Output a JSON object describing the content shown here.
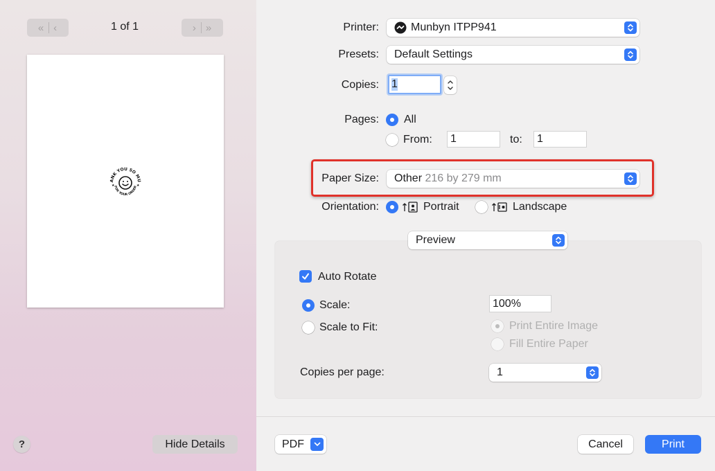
{
  "preview": {
    "page_count": "1 of 1",
    "stamp_text_top": "THANK YOU SO MUCH",
    "stamp_text_bottom": "FOR YOUR ORDER",
    "help_label": "?",
    "hide_details_label": "Hide Details"
  },
  "form": {
    "printer_label": "Printer:",
    "printer_value": "Munbyn ITPP941",
    "presets_label": "Presets:",
    "presets_value": "Default Settings",
    "copies_label": "Copies:",
    "copies_value": "1",
    "pages_label": "Pages:",
    "pages_all": "All",
    "pages_from_label": "From:",
    "pages_from_value": "1",
    "pages_to_label": "to:",
    "pages_to_value": "1",
    "paper_size_label": "Paper Size:",
    "paper_size_value": "Other",
    "paper_size_detail": "216 by 279 mm",
    "orientation_label": "Orientation:",
    "portrait_label": "Portrait",
    "landscape_label": "Landscape",
    "section_popup_value": "Preview"
  },
  "preview_options": {
    "auto_rotate_label": "Auto Rotate",
    "scale_label": "Scale:",
    "scale_value": "100%",
    "scale_to_fit_label": "Scale to Fit:",
    "print_entire_image_label": "Print Entire Image",
    "fill_entire_paper_label": "Fill Entire Paper",
    "copies_per_page_label": "Copies per page:",
    "copies_per_page_value": "1"
  },
  "footer": {
    "pdf_label": "PDF",
    "cancel_label": "Cancel",
    "print_label": "Print"
  },
  "colors": {
    "accent": "#3478f6",
    "highlight": "#e0322a"
  }
}
